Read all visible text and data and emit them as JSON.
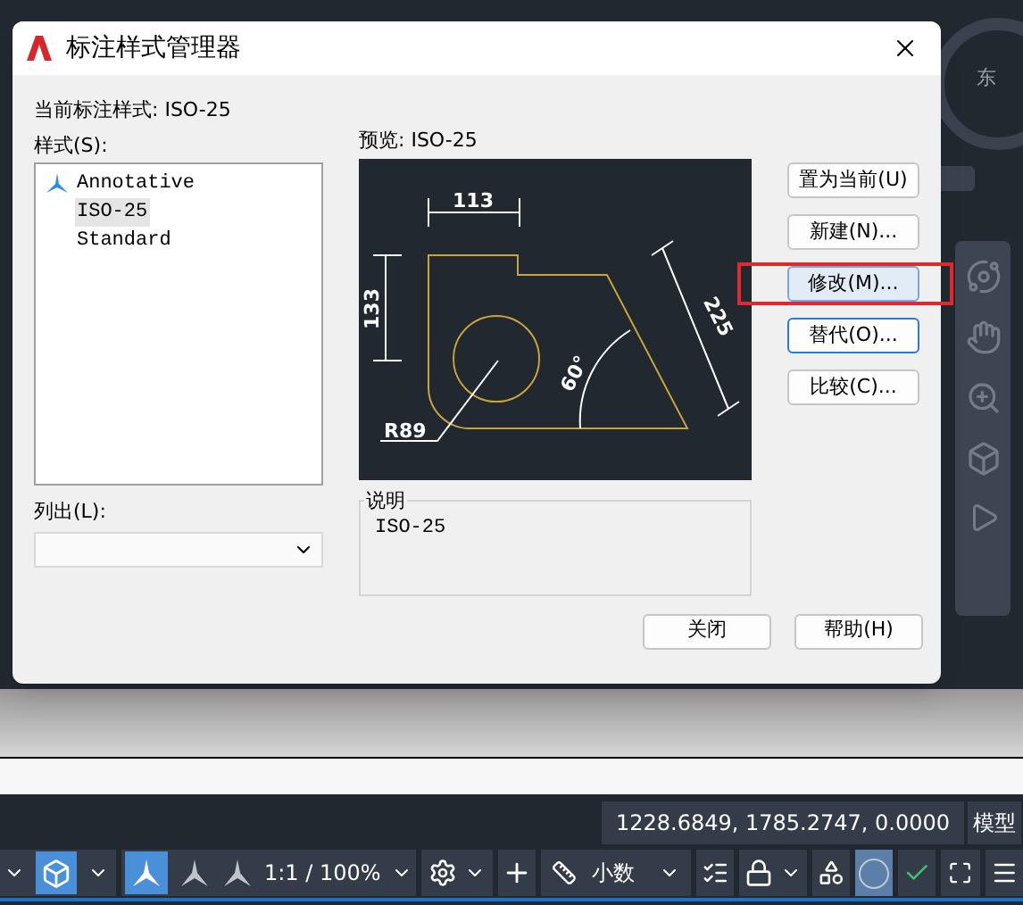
{
  "dialog": {
    "title": "标注样式管理器",
    "current_style": "当前标注样式: ISO-25",
    "styles_label": "样式(S):",
    "styles": [
      {
        "label": "Annotative",
        "kind": "annotative",
        "selected": false
      },
      {
        "label": "ISO-25",
        "kind": "plain",
        "selected": true
      },
      {
        "label": "Standard",
        "kind": "plain",
        "selected": false
      }
    ],
    "list_label": "列出(L):",
    "preview_label": "预览: ISO-25",
    "preview_dimensions": [
      "113",
      "133",
      "225",
      "60°",
      "R89"
    ],
    "buttons": [
      {
        "label": "置为当前(U)",
        "kind": "normal"
      },
      {
        "label": "新建(N)...",
        "kind": "normal"
      },
      {
        "label": "修改(M)...",
        "kind": "hover"
      },
      {
        "label": "替代(O)...",
        "kind": "default"
      },
      {
        "label": "比较(C)...",
        "kind": "normal"
      }
    ],
    "description": {
      "title": "说明",
      "text": "ISO-25"
    },
    "footer_buttons": [
      "关闭",
      "帮助(H)"
    ]
  },
  "nav_wheel": {
    "label": "东"
  },
  "status_bar": {
    "coordinates": "1228.6849, 1785.2747, 0.0000",
    "space": "模型"
  },
  "toolbar": {
    "isometric_on": true,
    "annotation_visible_on": true,
    "scale": "1:1 / 100%",
    "units": "小数",
    "selection_cycle_on": true
  }
}
